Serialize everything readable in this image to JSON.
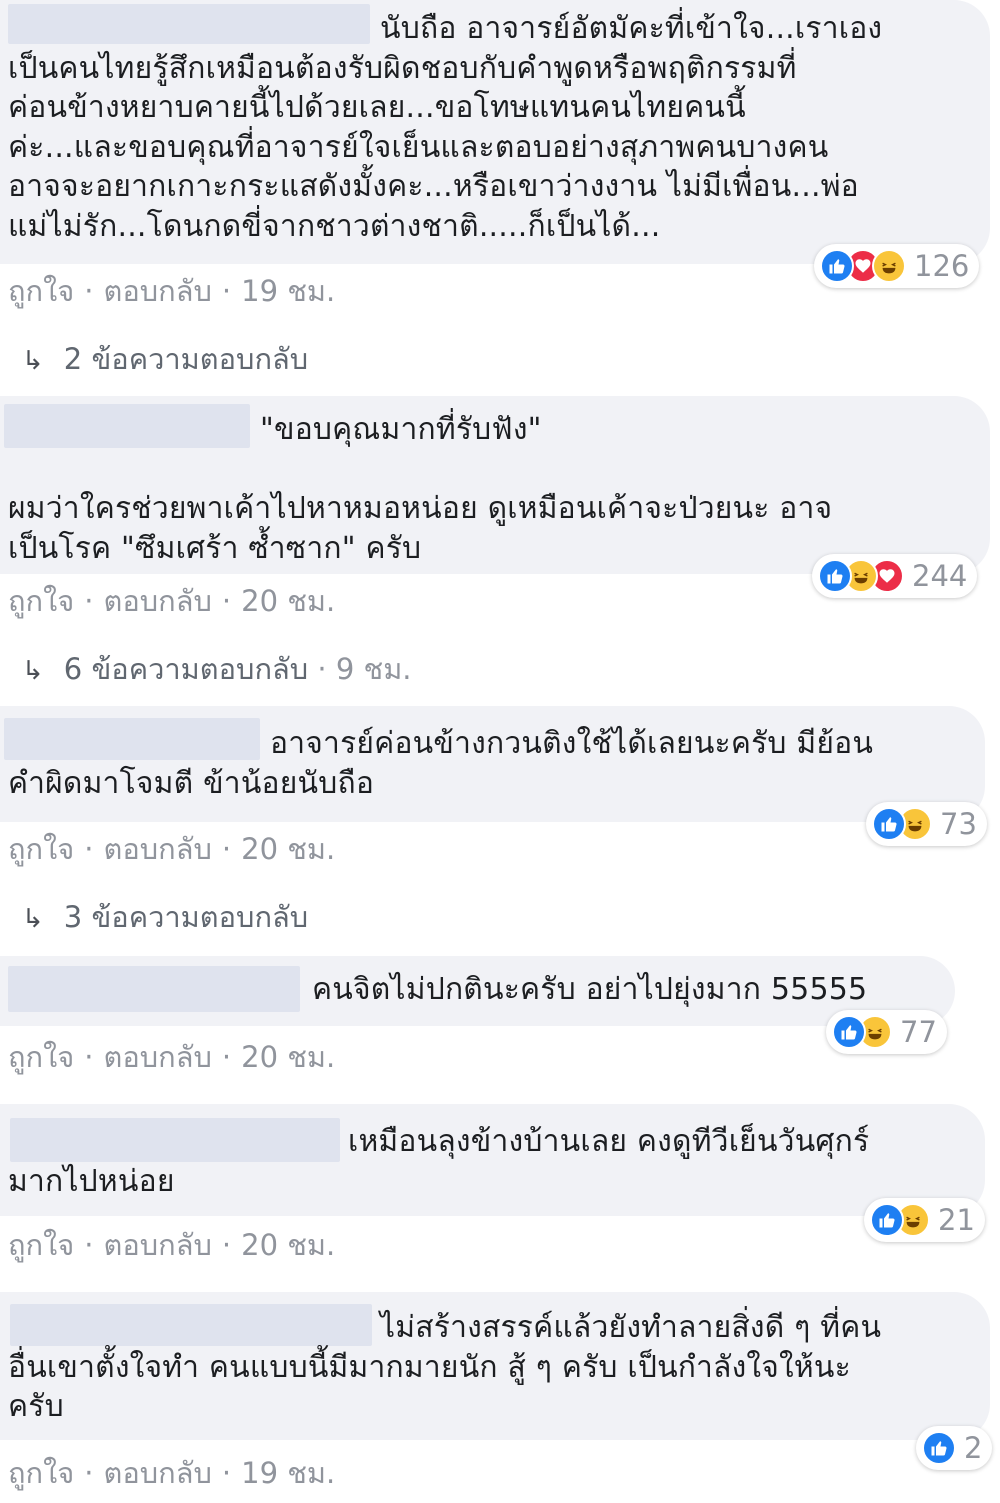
{
  "comments": [
    {
      "text": "นับถือ อาจารย์อัตมัคะที่เข้าใจ...เราเอง\nเป็นคนไทยรู้สึกเหมือนต้องรับผิดชอบกับคำพูดหรือพฤติกรรมที่\nค่อนข้างหยาบคายนี้ไปด้วยเลย...ขอโทษแทนคนไทยคนนี้\nค่ะ...และขอบคุณที่อาจารย์ใจเย็นและตอบอย่างสุภาพคนบางคน\nอาจจะอยากเกาะกระแสดังมั้งคะ...หรือเขาว่างงาน ไม่มีเพื่อน...พ่อ\nแม่ไม่รัก...โดนกดขี่จากชาวต่างชาติ.....ก็เป็นได้...",
      "like": "ถูกใจ",
      "reply": "ตอบกลับ",
      "time": "19 ชม.",
      "reaction_count": "126",
      "reactions": [
        "like-icon",
        "love-icon",
        "haha-icon"
      ],
      "replies_text": "2 ข้อความตอบกลับ",
      "replies_time": ""
    },
    {
      "text": "\"ขอบคุณมากที่รับฟัง\"\n\nผมว่าใครช่วยพาเค้าไปหาหมอหน่อย ดูเหมือนเค้าจะป่วยนะ อาจ\nเป็นโรค \"ซึมเศร้า ซ้ำซาก\" ครับ",
      "like": "ถูกใจ",
      "reply": "ตอบกลับ",
      "time": "20 ชม.",
      "reaction_count": "244",
      "reactions": [
        "like-icon",
        "haha-icon",
        "love-icon"
      ],
      "replies_text": "6 ข้อความตอบกลับ",
      "replies_time": "9 ชม."
    },
    {
      "text": "อาจารย์ค่อนข้างกวนติงใช้ได้เลยนะครับ มีย้อน\nคำผิดมาโจมตี ข้าน้อยนับถือ",
      "like": "ถูกใจ",
      "reply": "ตอบกลับ",
      "time": "20 ชม.",
      "reaction_count": "73",
      "reactions": [
        "like-icon",
        "haha-icon"
      ],
      "replies_text": "3 ข้อความตอบกลับ",
      "replies_time": ""
    },
    {
      "text": "คนจิตไม่ปกตินะครับ อย่าไปยุ่งมาก 55555",
      "like": "ถูกใจ",
      "reply": "ตอบกลับ",
      "time": "20 ชม.",
      "reaction_count": "77",
      "reactions": [
        "like-icon",
        "haha-icon"
      ],
      "replies_text": "",
      "replies_time": ""
    },
    {
      "text": "เหมือนลุงข้างบ้านเลย คงดูทีวีเย็นวันศุกร์\nมากไปหน่อย",
      "like": "ถูกใจ",
      "reply": "ตอบกลับ",
      "time": "20 ชม.",
      "reaction_count": "21",
      "reactions": [
        "like-icon",
        "haha-icon"
      ],
      "replies_text": "",
      "replies_time": ""
    },
    {
      "text": "ไม่สร้างสรรค์แล้วยังทำลายสิ่งดี ๆ ที่คน\nอื่นเขาตั้งใจทำ คนแบบนี้มีมากมายนัก สู้ ๆ ครับ เป็นกำลังใจให้นะ\nครับ",
      "like": "ถูกใจ",
      "reply": "ตอบกลับ",
      "time": "19 ชม.",
      "reaction_count": "2",
      "reactions": [
        "like-icon"
      ],
      "replies_text": "",
      "replies_time": ""
    }
  ],
  "colors": {
    "bubble": "#f1f2f6",
    "like": "#1e7ff2",
    "haha": "#f9c53a",
    "love": "#ec2d47",
    "meta": "#90949c"
  }
}
